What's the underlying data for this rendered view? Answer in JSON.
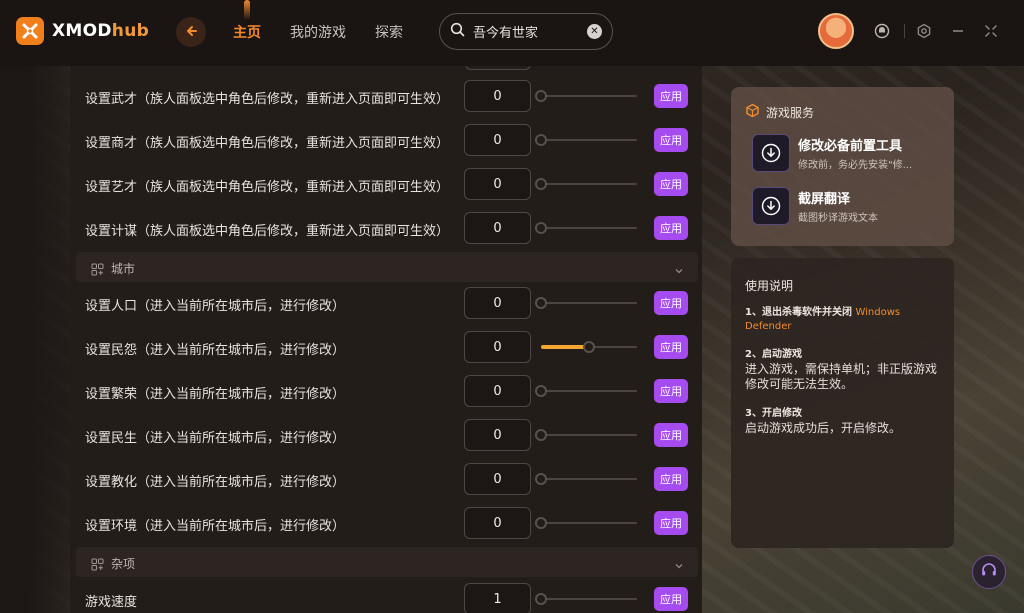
{
  "app": {
    "logo_text": "XMOD",
    "logo_suffix": "hub"
  },
  "nav": {
    "items": [
      {
        "label": "主页",
        "active": true
      },
      {
        "label": "我的游戏",
        "active": false
      },
      {
        "label": "探索",
        "active": false
      }
    ]
  },
  "search": {
    "value": "吾今有世家",
    "clear_icon": "close-icon"
  },
  "settings_rows_a": [
    {
      "label": "设置武才（族人面板选中角色后修改，重新进入页面即可生效）",
      "value": "0",
      "level": 0
    },
    {
      "label": "设置商才（族人面板选中角色后修改，重新进入页面即可生效）",
      "value": "0",
      "level": 0
    },
    {
      "label": "设置艺才（族人面板选中角色后修改，重新进入页面即可生效）",
      "value": "0",
      "level": 0
    },
    {
      "label": "设置计谋（族人面板选中角色后修改，重新进入页面即可生效）",
      "value": "0",
      "level": 0
    }
  ],
  "section_city": {
    "label": "城市"
  },
  "settings_rows_city": [
    {
      "label": "设置人口（进入当前所在城市后，进行修改）",
      "value": "0",
      "level": 0
    },
    {
      "label": "设置民怨（进入当前所在城市后，进行修改）",
      "value": "0",
      "level": 0.5
    },
    {
      "label": "设置繁荣（进入当前所在城市后，进行修改）",
      "value": "0",
      "level": 0
    },
    {
      "label": "设置民生（进入当前所在城市后，进行修改）",
      "value": "0",
      "level": 0
    },
    {
      "label": "设置教化（进入当前所在城市后，进行修改）",
      "value": "0",
      "level": 0
    },
    {
      "label": "设置环境（进入当前所在城市后，进行修改）",
      "value": "0",
      "level": 0
    }
  ],
  "section_misc": {
    "label": "杂项"
  },
  "settings_rows_misc": [
    {
      "label": "游戏速度",
      "value": "1",
      "level": 0
    }
  ],
  "apply_label": "应用",
  "services": {
    "title": "游戏服务",
    "items": [
      {
        "title": "修改必备前置工具",
        "subtitle": "修改前，务必先安装\"修..."
      },
      {
        "title": "截屏翻译",
        "subtitle": "截图秒译游戏文本"
      }
    ]
  },
  "help": {
    "title": "使用说明",
    "steps": [
      {
        "head": "1、退出杀毒软件并关闭",
        "accent": "Windows Defender",
        "body": ""
      },
      {
        "head": "2、启动游戏",
        "accent": "",
        "body": "进入游戏，需保持单机；非正版游戏修改可能无法生效。"
      },
      {
        "head": "3、开启修改",
        "accent": "",
        "body": "启动游戏成功后，开启修改。"
      }
    ]
  },
  "colors": {
    "accent_orange": "#f58a2a",
    "apply_purple": "#a64bf0",
    "slider_fill": "#f5a531"
  }
}
